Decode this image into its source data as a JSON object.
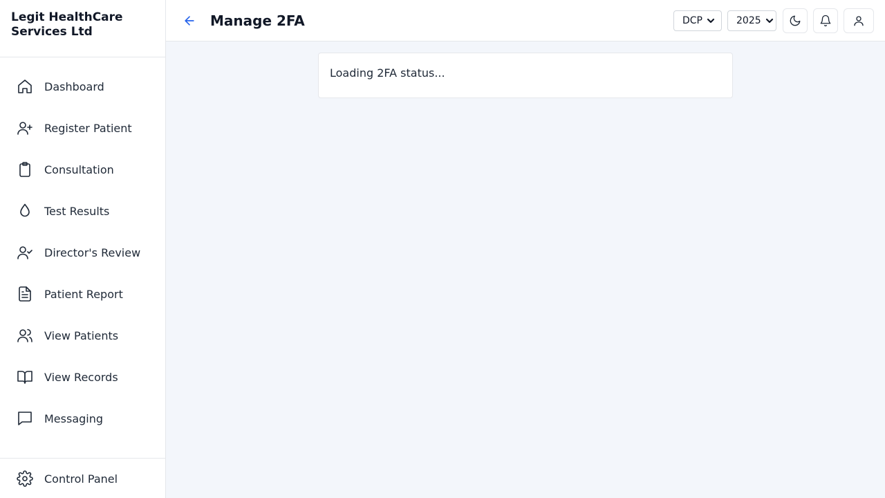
{
  "brand": {
    "name": "Legit HealthCare Services Ltd"
  },
  "sidebar": {
    "items": [
      {
        "label": "Dashboard",
        "icon": "home-icon"
      },
      {
        "label": "Register Patient",
        "icon": "user-plus-icon"
      },
      {
        "label": "Consultation",
        "icon": "clipboard-icon"
      },
      {
        "label": "Test Results",
        "icon": "droplet-icon"
      },
      {
        "label": "Director's Review",
        "icon": "user-check-icon"
      },
      {
        "label": "Patient Report",
        "icon": "file-text-icon"
      },
      {
        "label": "View Patients",
        "icon": "users-icon"
      },
      {
        "label": "View Records",
        "icon": "book-open-icon"
      },
      {
        "label": "Messaging",
        "icon": "message-square-icon"
      }
    ],
    "bottom": {
      "label": "Control Panel",
      "icon": "gear-icon"
    }
  },
  "header": {
    "title": "Manage 2FA",
    "org_select": "DCP",
    "year_select": "2025"
  },
  "main": {
    "status_text": "Loading 2FA status..."
  },
  "colors": {
    "accent": "#2563eb",
    "background": "#f3f6fb"
  }
}
